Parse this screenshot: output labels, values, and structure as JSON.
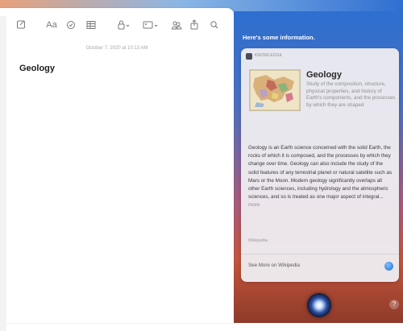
{
  "notes": {
    "toolbar": {
      "format_label": "Aa"
    },
    "date": "October 7, 2020 at 10:13 AM",
    "title": "Geology"
  },
  "siri": {
    "header": "Here's some information.",
    "card": {
      "section_label": "KNOWLEDGE",
      "title": "Geology",
      "description": "Study of the composition, structure, physical properties, and history of Earth's components, and the processes by which they are shaped",
      "body": "Geology is an Earth science concerned with the solid Earth, the rocks of which it is composed, and the processes by which they change over time. Geology can also include the study of the solid features of any terrestrial planet or natural satellite such as Mars or the Moon. Modern geology significantly overlaps all other Earth sciences, including hydrology and the atmospheric sciences, and so is treated as one major aspect of integral...",
      "more_label": "more",
      "source": "Wikipedia",
      "link_label": "See More on Wikipedia"
    }
  },
  "colors": {
    "siri_top": "#2d6fd0",
    "siri_bottom": "#c2553c",
    "card_bg": "#eeecf0"
  },
  "icons": [
    "compose-icon",
    "format-icon",
    "checklist-icon",
    "table-icon",
    "lock-icon",
    "media-icon",
    "collaborate-icon",
    "share-icon",
    "search-icon",
    "knowledge-icon",
    "safari-icon",
    "siri-orb-icon",
    "help-icon"
  ]
}
